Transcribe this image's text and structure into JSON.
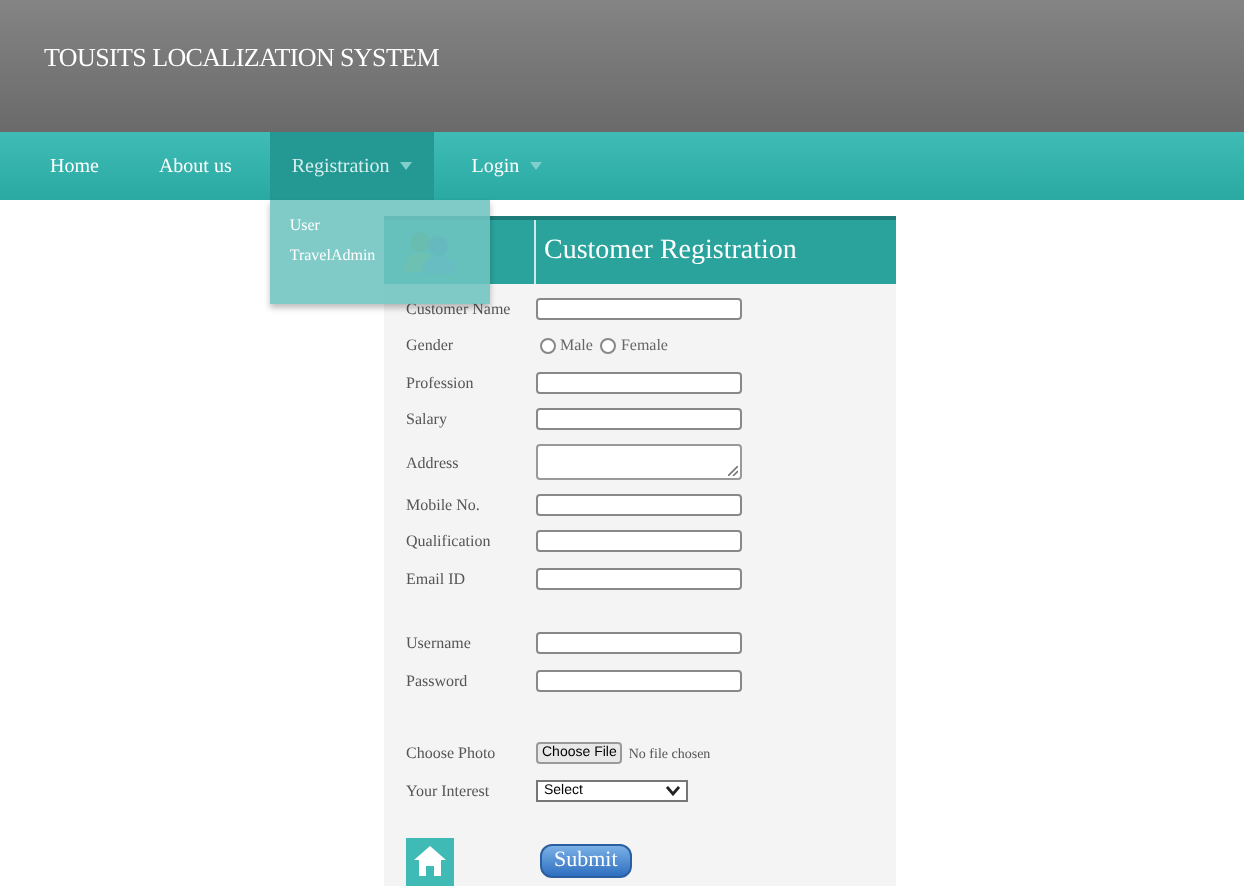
{
  "header": {
    "title": "TOUSITS LOCALIZATION SYSTEM"
  },
  "nav": [
    {
      "label": "Home",
      "selected": false,
      "caret": false
    },
    {
      "label": "About us",
      "selected": false,
      "caret": false
    },
    {
      "label": "Registration",
      "selected": true,
      "caret": true,
      "menu": [
        "User",
        "TravelAdmin"
      ]
    },
    {
      "label": "Login",
      "selected": false,
      "caret": true
    }
  ],
  "form": {
    "title": "Customer Registration",
    "sections": [
      [
        {
          "label": "Customer Name",
          "kind": "text"
        },
        {
          "label": "Gender",
          "kind": "radio",
          "options": [
            {
              "label": "Male",
              "selected": false
            },
            {
              "label": "Female",
              "selected": false
            }
          ]
        },
        {
          "label": "Profession",
          "kind": "text"
        },
        {
          "label": "Salary",
          "kind": "text"
        },
        {
          "label": "Address",
          "kind": "textarea"
        },
        {
          "label": "Mobile No.",
          "kind": "text"
        },
        {
          "label": "Qualification",
          "kind": "text"
        },
        {
          "label": "Email ID",
          "kind": "text"
        }
      ],
      [
        {
          "label": "Username",
          "kind": "text"
        },
        {
          "label": "Password",
          "kind": "password"
        }
      ],
      [
        {
          "label": "Choose Photo",
          "kind": "file",
          "button": "Choose File",
          "status": "No file chosen"
        },
        {
          "label": "Your Interest",
          "kind": "select",
          "value": "Select"
        }
      ]
    ],
    "submit": "Submit"
  }
}
